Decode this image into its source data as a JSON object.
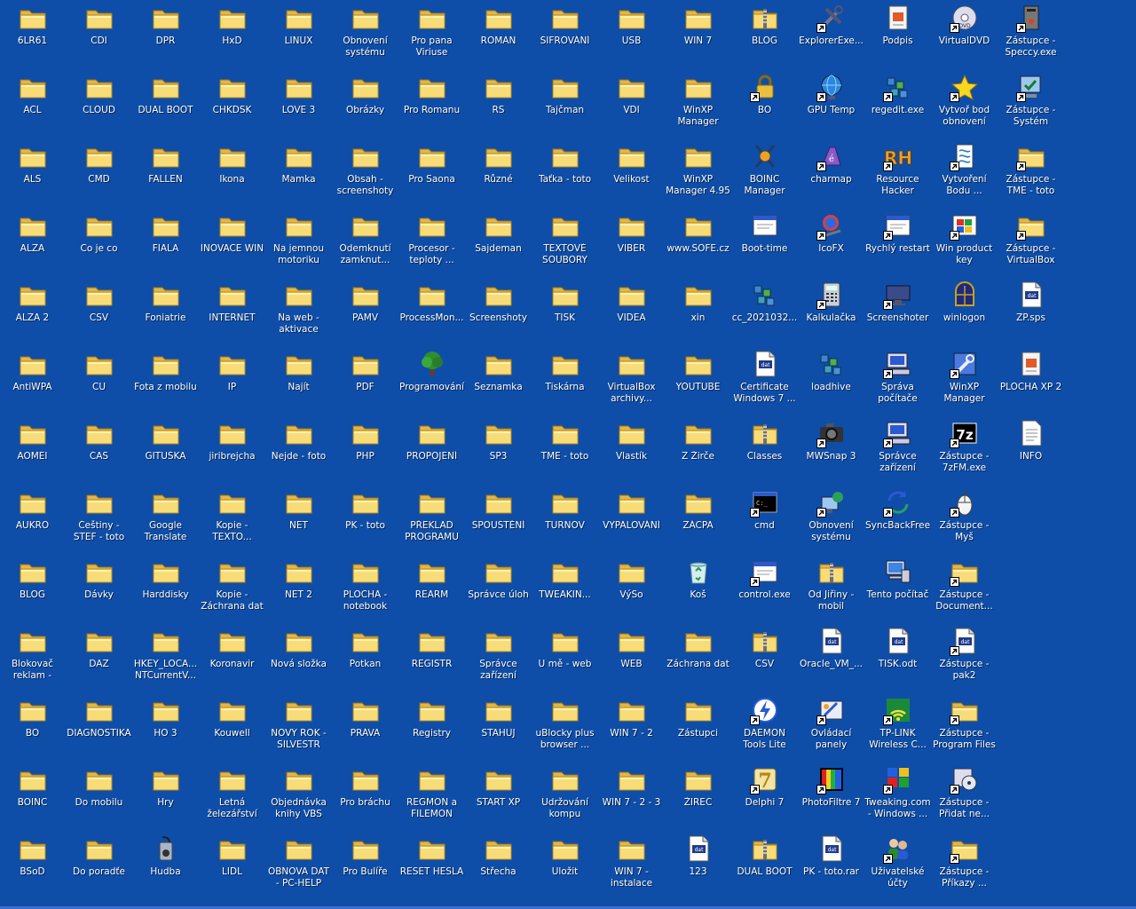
{
  "desktop": {
    "columns": [
      [
        {
          "label": "6LR61",
          "icon": "folder"
        },
        {
          "label": "ACL",
          "icon": "folder"
        },
        {
          "label": "ALS",
          "icon": "folder"
        },
        {
          "label": "ALZA",
          "icon": "folder"
        },
        {
          "label": "ALZA 2",
          "icon": "folder"
        },
        {
          "label": "AntiWPA",
          "icon": "folder"
        },
        {
          "label": "AOMEI",
          "icon": "folder"
        },
        {
          "label": "AUKRO",
          "icon": "folder"
        },
        {
          "label": "BLOG",
          "icon": "folder"
        },
        {
          "label": "Blokovač reklam - uBlock",
          "icon": "folder"
        },
        {
          "label": "BO",
          "icon": "folder"
        },
        {
          "label": "BOINC",
          "icon": "folder"
        },
        {
          "label": "BSoD",
          "icon": "folder"
        }
      ],
      [
        {
          "label": "CDI",
          "icon": "folder"
        },
        {
          "label": "CLOUD",
          "icon": "folder"
        },
        {
          "label": "CMD",
          "icon": "folder"
        },
        {
          "label": "Co je co",
          "icon": "folder"
        },
        {
          "label": "CSV",
          "icon": "folder"
        },
        {
          "label": "CU",
          "icon": "folder"
        },
        {
          "label": "ČAS",
          "icon": "folder"
        },
        {
          "label": "Češtiny - STEF - toto",
          "icon": "folder"
        },
        {
          "label": "Dávky",
          "icon": "folder"
        },
        {
          "label": "DAZ",
          "icon": "folder"
        },
        {
          "label": "DIAGNOSTIKA",
          "icon": "folder"
        },
        {
          "label": "Do mobilu",
          "icon": "folder"
        },
        {
          "label": "Do poradťe",
          "icon": "folder"
        }
      ],
      [
        {
          "label": "DPR",
          "icon": "folder"
        },
        {
          "label": "DUAL BOOT",
          "icon": "folder"
        },
        {
          "label": "FALLEN",
          "icon": "folder"
        },
        {
          "label": "FIALA",
          "icon": "folder"
        },
        {
          "label": "Foniatrie",
          "icon": "folder"
        },
        {
          "label": "Fota z mobilu",
          "icon": "folder"
        },
        {
          "label": "GITUŠKA",
          "icon": "folder"
        },
        {
          "label": "Google Translate",
          "icon": "folder"
        },
        {
          "label": "Harddisky",
          "icon": "folder"
        },
        {
          "label": "HKEY_LOCA... NTCurrentV...",
          "icon": "folder"
        },
        {
          "label": "HO 3",
          "icon": "folder"
        },
        {
          "label": "Hry",
          "icon": "folder"
        },
        {
          "label": "Hudba",
          "icon": "hudba"
        }
      ],
      [
        {
          "label": "HxD",
          "icon": "folder"
        },
        {
          "label": "CHKDSK",
          "icon": "folder"
        },
        {
          "label": "Ikona",
          "icon": "folder"
        },
        {
          "label": "INOVACE WIN",
          "icon": "folder"
        },
        {
          "label": "INTERNET",
          "icon": "folder"
        },
        {
          "label": "IP",
          "icon": "folder"
        },
        {
          "label": "jiribrejcha",
          "icon": "folder"
        },
        {
          "label": "Kopie - TEXTO...",
          "icon": "folder"
        },
        {
          "label": "Kopie - Záchrana dat",
          "icon": "folder"
        },
        {
          "label": "Koronavir",
          "icon": "folder"
        },
        {
          "label": "Kouwell",
          "icon": "folder"
        },
        {
          "label": "Letná železářství",
          "icon": "folder"
        },
        {
          "label": "LIDL",
          "icon": "folder"
        }
      ],
      [
        {
          "label": "LINUX",
          "icon": "folder"
        },
        {
          "label": "LOVE 3",
          "icon": "folder"
        },
        {
          "label": "Mamka",
          "icon": "folder"
        },
        {
          "label": "Na jemnou motoriku",
          "icon": "folder"
        },
        {
          "label": "Na web - aktivace",
          "icon": "folder"
        },
        {
          "label": "Najít",
          "icon": "folder"
        },
        {
          "label": "Nejde - foto",
          "icon": "folder"
        },
        {
          "label": "NET",
          "icon": "folder"
        },
        {
          "label": "NET 2",
          "icon": "folder"
        },
        {
          "label": "Nová složka",
          "icon": "folder"
        },
        {
          "label": "NOVÝ ROK - SILVESTR",
          "icon": "folder"
        },
        {
          "label": "Objednávka knihy VBS",
          "icon": "folder"
        },
        {
          "label": "OBNOVA DAT - PC-HELP",
          "icon": "folder"
        }
      ],
      [
        {
          "label": "Obnovení systému",
          "icon": "folder"
        },
        {
          "label": "Obrázky",
          "icon": "folder"
        },
        {
          "label": "Obsah - screenshoty",
          "icon": "folder"
        },
        {
          "label": "Odemknutí zamknut...",
          "icon": "folder"
        },
        {
          "label": "PAMV",
          "icon": "folder"
        },
        {
          "label": "PDF",
          "icon": "folder"
        },
        {
          "label": "PHP",
          "icon": "folder"
        },
        {
          "label": "PK - toto",
          "icon": "folder"
        },
        {
          "label": "PLOCHA - notebook",
          "icon": "folder"
        },
        {
          "label": "Potkan",
          "icon": "folder"
        },
        {
          "label": "PRÁVA",
          "icon": "folder"
        },
        {
          "label": "Pro bráchu",
          "icon": "folder"
        },
        {
          "label": "Pro Bulíře",
          "icon": "folder"
        }
      ],
      [
        {
          "label": "Pro pana Viriuse",
          "icon": "folder"
        },
        {
          "label": "Pro Romanu",
          "icon": "folder"
        },
        {
          "label": "Pro Saona",
          "icon": "folder"
        },
        {
          "label": "Procesor - teploty ...",
          "icon": "folder"
        },
        {
          "label": "ProcessMon...",
          "icon": "folder"
        },
        {
          "label": "Programování",
          "icon": "tree"
        },
        {
          "label": "PROPOJENÍ",
          "icon": "folder"
        },
        {
          "label": "PŘEKLAD PROGRAMU",
          "icon": "folder"
        },
        {
          "label": "REARM",
          "icon": "folder"
        },
        {
          "label": "REGISTR",
          "icon": "folder"
        },
        {
          "label": "Registry",
          "icon": "folder"
        },
        {
          "label": "REGMON a FILEMON",
          "icon": "folder"
        },
        {
          "label": "RESET HESLA",
          "icon": "folder"
        }
      ],
      [
        {
          "label": "ROMAN",
          "icon": "folder"
        },
        {
          "label": "RS",
          "icon": "folder"
        },
        {
          "label": "Různé",
          "icon": "folder"
        },
        {
          "label": "Sajdeman",
          "icon": "folder"
        },
        {
          "label": "Screenshoty",
          "icon": "folder"
        },
        {
          "label": "Seznamka",
          "icon": "folder"
        },
        {
          "label": "SP3",
          "icon": "folder"
        },
        {
          "label": "SPOUŠTĚNÍ",
          "icon": "folder"
        },
        {
          "label": "Správce úloh",
          "icon": "folder"
        },
        {
          "label": "Správce zařízení",
          "icon": "folder"
        },
        {
          "label": "STAHUJ",
          "icon": "folder"
        },
        {
          "label": "START XP",
          "icon": "folder"
        },
        {
          "label": "Střecha",
          "icon": "folder"
        }
      ],
      [
        {
          "label": "ŠIFROVÁNÍ",
          "icon": "folder"
        },
        {
          "label": "Tajčman",
          "icon": "folder"
        },
        {
          "label": "Taťka - toto",
          "icon": "folder"
        },
        {
          "label": "TEXTOVÉ SOUBORY",
          "icon": "folder"
        },
        {
          "label": "TISK",
          "icon": "folder"
        },
        {
          "label": "Tiskárna",
          "icon": "folder"
        },
        {
          "label": "TME - toto",
          "icon": "folder"
        },
        {
          "label": "TURNOV",
          "icon": "folder"
        },
        {
          "label": "TWEAKIN...",
          "icon": "folder"
        },
        {
          "label": "U mě - web",
          "icon": "folder"
        },
        {
          "label": "uBlocky plus browser ...",
          "icon": "folder"
        },
        {
          "label": "Udržování kompu",
          "icon": "folder"
        },
        {
          "label": "Uložit",
          "icon": "folder"
        }
      ],
      [
        {
          "label": "USB",
          "icon": "folder"
        },
        {
          "label": "VDI",
          "icon": "folder"
        },
        {
          "label": "Velikost",
          "icon": "folder"
        },
        {
          "label": "VIBER",
          "icon": "folder"
        },
        {
          "label": "VIDEA",
          "icon": "folder"
        },
        {
          "label": "VirtualBox archivy...",
          "icon": "folder"
        },
        {
          "label": "Vlastík",
          "icon": "folder"
        },
        {
          "label": "VYPALOVÁNÍ",
          "icon": "folder"
        },
        {
          "label": "VýSo",
          "icon": "folder"
        },
        {
          "label": "WEB",
          "icon": "folder"
        },
        {
          "label": "WIN 7 - 2",
          "icon": "folder"
        },
        {
          "label": "WIN 7 - 2 - 3",
          "icon": "folder"
        },
        {
          "label": "WIN 7 - instalace",
          "icon": "folder"
        }
      ],
      [
        {
          "label": "WIN  7",
          "icon": "folder"
        },
        {
          "label": "WinXP Manager",
          "icon": "folder"
        },
        {
          "label": "WinXP Manager 4.95",
          "icon": "folder"
        },
        {
          "label": "www.SOFE.cz",
          "icon": "folder"
        },
        {
          "label": "xin",
          "icon": "folder"
        },
        {
          "label": "YOUTUBE",
          "icon": "folder"
        },
        {
          "label": "Z Žirče",
          "icon": "folder"
        },
        {
          "label": "ZÁCPA",
          "icon": "folder"
        },
        {
          "label": "Koš",
          "icon": "recycle"
        },
        {
          "label": "Záchrana dat",
          "icon": "folder"
        },
        {
          "label": "Zástupci",
          "icon": "folder"
        },
        {
          "label": "ŽIREČ",
          "icon": "folder"
        },
        {
          "label": "123",
          "icon": "doc"
        }
      ],
      [
        {
          "label": "BLOG",
          "icon": "zip"
        },
        {
          "label": "BO",
          "icon": "lock",
          "shortcut": true
        },
        {
          "label": "BOINC Manager",
          "icon": "boinc"
        },
        {
          "label": "Boot-time",
          "icon": "window"
        },
        {
          "label": "cc_2021032...",
          "icon": "reg"
        },
        {
          "label": "Certificate Windows 7 ...",
          "icon": "doc"
        },
        {
          "label": "Classes",
          "icon": "zip"
        },
        {
          "label": "cmd",
          "icon": "cmd",
          "shortcut": true
        },
        {
          "label": "control.exe",
          "icon": "window",
          "shortcut": true
        },
        {
          "label": "CSV",
          "icon": "zip"
        },
        {
          "label": "DAEMON Tools Lite",
          "icon": "daemon",
          "shortcut": true
        },
        {
          "label": "Delphi 7",
          "icon": "delphi",
          "shortcut": true
        },
        {
          "label": "DUAL BOOT",
          "icon": "zip"
        }
      ],
      [
        {
          "label": "ExplorerExe...",
          "icon": "tools",
          "shortcut": true
        },
        {
          "label": "GPU Temp",
          "icon": "globe",
          "shortcut": true
        },
        {
          "label": "charmap",
          "icon": "charmap",
          "shortcut": true
        },
        {
          "label": "IcoFX",
          "icon": "icofx",
          "shortcut": true
        },
        {
          "label": "Kalkulačka",
          "icon": "calc",
          "shortcut": true
        },
        {
          "label": "loadhive",
          "icon": "reg"
        },
        {
          "label": "MWSnap 3",
          "icon": "camera",
          "shortcut": true
        },
        {
          "label": "Obnovení systému",
          "icon": "restore",
          "shortcut": true
        },
        {
          "label": "Od Jiřiny - mobil",
          "icon": "zip"
        },
        {
          "label": "Oracle_VM_...",
          "icon": "doc"
        },
        {
          "label": "Ovládací panely",
          "icon": "panel",
          "shortcut": true
        },
        {
          "label": "PhotoFiltre 7",
          "icon": "photo",
          "shortcut": true
        },
        {
          "label": "PK - toto.rar",
          "icon": "doc"
        }
      ],
      [
        {
          "label": "Podpis",
          "icon": "podpis"
        },
        {
          "label": "regedit.exe",
          "icon": "reg",
          "shortcut": true
        },
        {
          "label": "Resource Hacker",
          "icon": "rh",
          "shortcut": true
        },
        {
          "label": "Rychlý restart",
          "icon": "window",
          "shortcut": true
        },
        {
          "label": "Screenshoter",
          "icon": "screen",
          "shortcut": true
        },
        {
          "label": "Správa počítače",
          "icon": "computer",
          "shortcut": true
        },
        {
          "label": "Správce zařízení",
          "icon": "computer",
          "shortcut": true
        },
        {
          "label": "SyncBackFree",
          "icon": "sync",
          "shortcut": true
        },
        {
          "label": "Tento počítač",
          "icon": "mycomputer"
        },
        {
          "label": "TISK.odt",
          "icon": "doc"
        },
        {
          "label": "TP-LINK Wireless C...",
          "icon": "wifi",
          "shortcut": true
        },
        {
          "label": "Tweaking.com - Windows ...",
          "icon": "tweak",
          "shortcut": true
        },
        {
          "label": "Uživatelské účty",
          "icon": "users",
          "shortcut": true
        }
      ],
      [
        {
          "label": "VirtualDVD",
          "icon": "dvd",
          "shortcut": true
        },
        {
          "label": "Vytvoř bod obnovení",
          "icon": "star",
          "shortcut": true
        },
        {
          "label": "Vytvoření Bodu ...",
          "icon": "script",
          "shortcut": true
        },
        {
          "label": "Win product key",
          "icon": "winlogo",
          "shortcut": true
        },
        {
          "label": "winlogon",
          "icon": "winlogon"
        },
        {
          "label": "WinXP Manager",
          "icon": "wrench",
          "shortcut": true
        },
        {
          "label": "Zástupce - 7zFM.exe",
          "icon": "sevenz",
          "shortcut": true
        },
        {
          "label": "Zástupce - Myš",
          "icon": "mouse",
          "shortcut": true
        },
        {
          "label": "Zástupce - Document...",
          "icon": "folder",
          "shortcut": true
        },
        {
          "label": "Zástupce - pak2",
          "icon": "doc",
          "shortcut": true
        },
        {
          "label": "Zástupce - Program Files",
          "icon": "folder",
          "shortcut": true
        },
        {
          "label": "Zástupce - Přidat ne...",
          "icon": "addhw",
          "shortcut": true
        },
        {
          "label": "Zástupce - Příkazy ...",
          "icon": "folder",
          "shortcut": true
        }
      ],
      [
        {
          "label": "Zástupce - Speccy.exe",
          "icon": "speccy",
          "shortcut": true
        },
        {
          "label": "Zástupce - Systém",
          "icon": "system",
          "shortcut": true
        },
        {
          "label": "Zástupce - TME - toto",
          "icon": "folder",
          "shortcut": true
        },
        {
          "label": "Zástupce - VirtualBox VMs",
          "icon": "folder",
          "shortcut": true
        },
        {
          "label": "ZP.sps",
          "icon": "doc"
        },
        {
          "label": "PLOCHA XP 2",
          "icon": "podpis"
        },
        {
          "label": "INFO",
          "icon": "textdoc"
        }
      ]
    ]
  }
}
